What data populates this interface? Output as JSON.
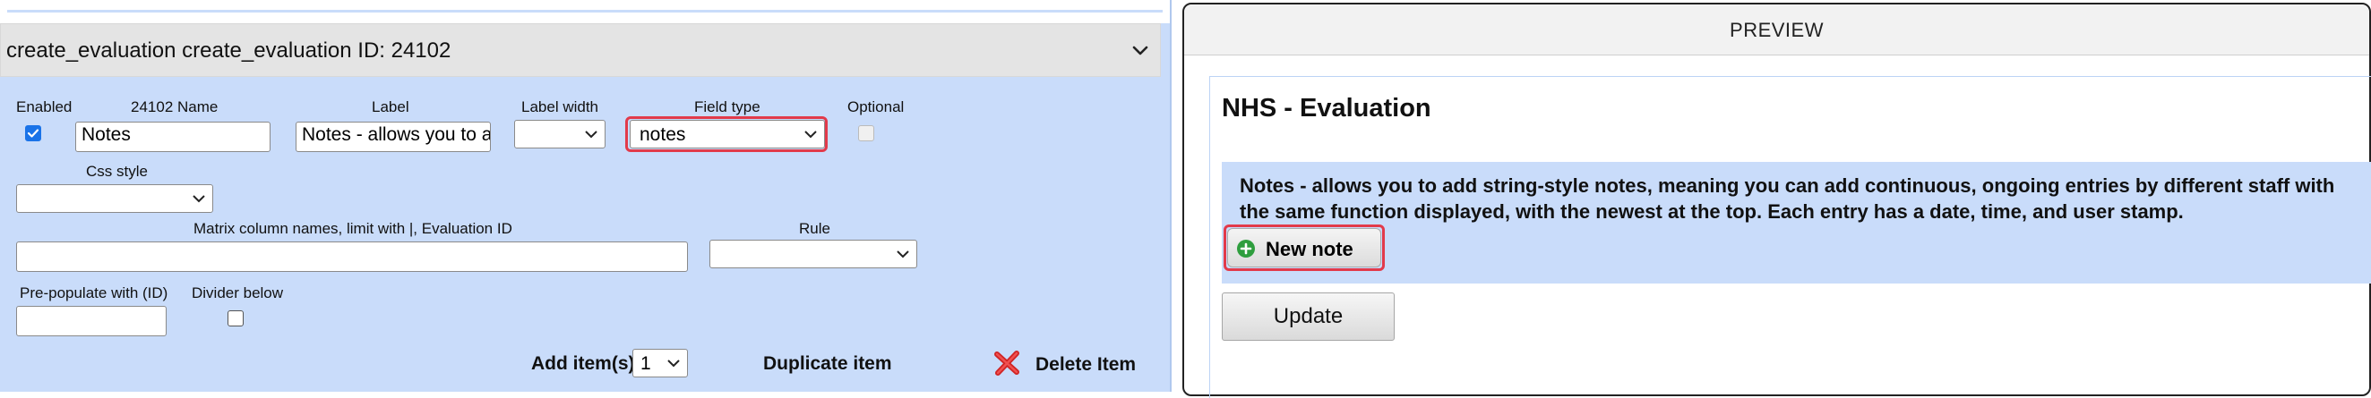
{
  "editor": {
    "item_title": "create_evaluation create_evaluation ID: 24102",
    "fields": {
      "enabled_label": "Enabled",
      "enabled_checked": true,
      "name_label": "24102 Name",
      "name_value": "Notes",
      "label_label": "Label",
      "label_value": "Notes - allows you to a",
      "label_width_label": "Label width",
      "label_width_value": "",
      "field_type_label": "Field type",
      "field_type_value": "notes",
      "optional_label": "Optional",
      "optional_checked": false,
      "css_style_label": "Css style",
      "css_style_value": "",
      "matrix_label": "Matrix column names, limit with |, Evaluation ID",
      "matrix_value": "",
      "rule_label": "Rule",
      "rule_value": "",
      "prepopulate_label": "Pre-populate with (ID)",
      "prepopulate_value": "",
      "divider_label": "Divider below",
      "divider_checked": false
    },
    "actions": {
      "add_items_label": "Add item(s)",
      "add_items_count": "1",
      "duplicate_label": "Duplicate item",
      "delete_label": "Delete Item"
    },
    "highlight_color": "#e23a4a",
    "panel_color": "#c9dcfa"
  },
  "preview": {
    "header": "PREVIEW",
    "form_title": "NHS - Evaluation",
    "notes_text": "Notes - allows you to add string-style notes, meaning you can add continuous, ongoing entries by different staff with the same function displayed, with the newest at the top. Each entry has a date, time, and user stamp.",
    "new_note_label": "New note",
    "update_label": "Update"
  },
  "icons": [
    "chevron-down-icon",
    "plus-circle-icon",
    "delete-x-icon",
    "checkmark-icon"
  ]
}
